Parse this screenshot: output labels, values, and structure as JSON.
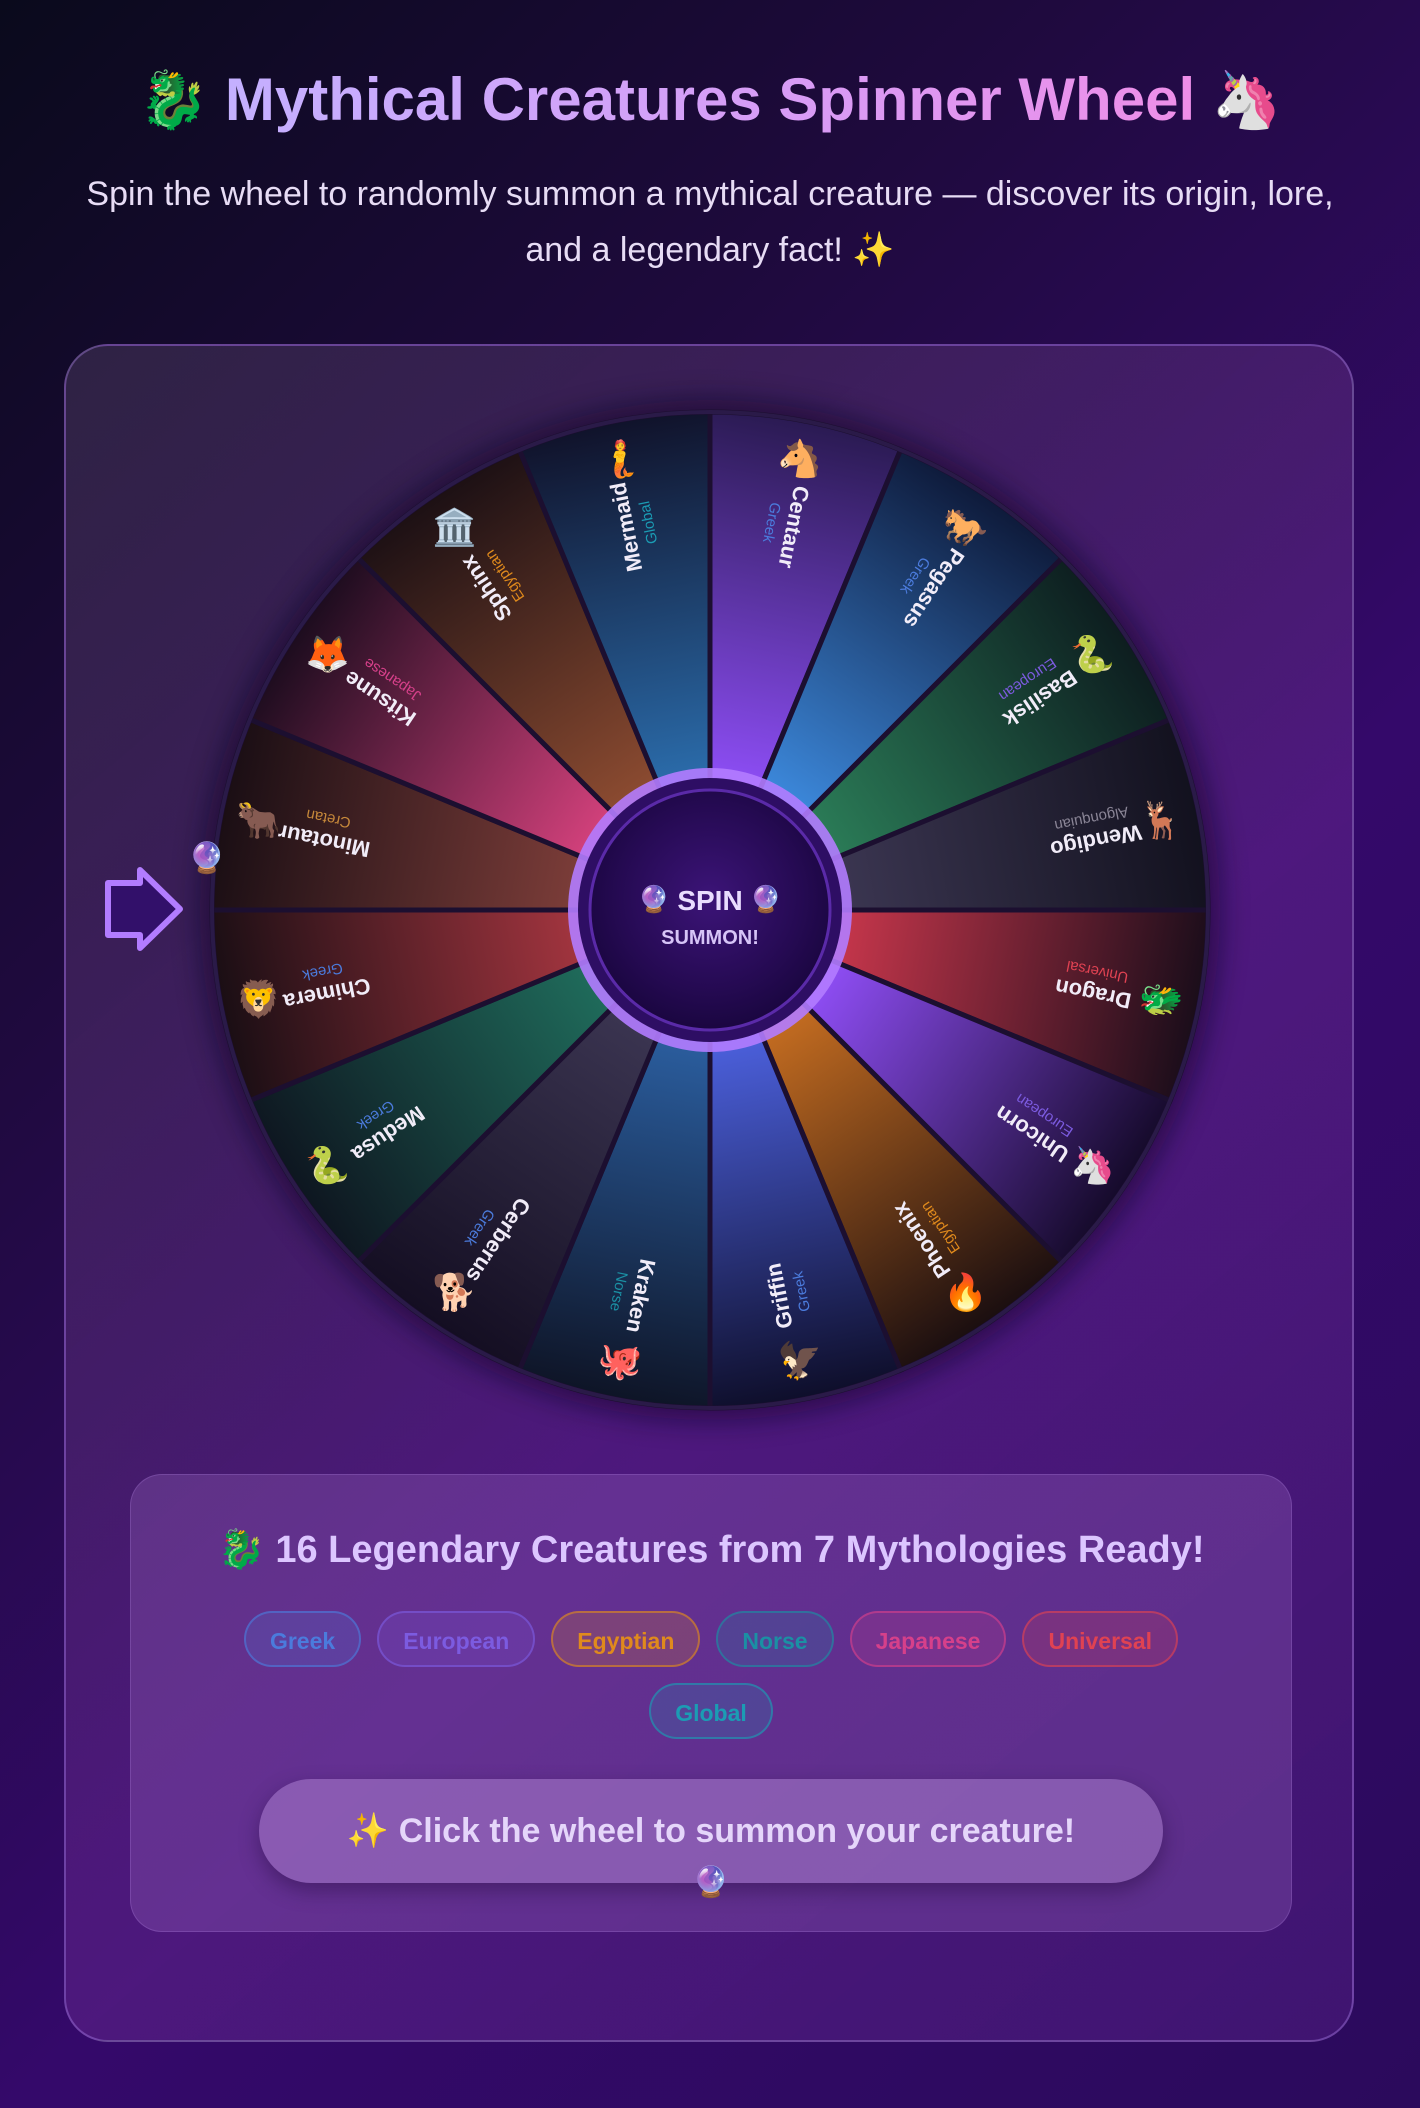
{
  "header": {
    "title_icon_left": "🐉",
    "title": "Mythical Creatures Spinner Wheel",
    "title_icon_right": "🦄",
    "subtitle": "Spin the wheel to randomly summon a mythical creature — discover its origin, lore, and a legendary fact! ✨"
  },
  "wheel": {
    "hub_icon": "🔮",
    "hub_label": "SPIN",
    "hub_sub": "SUMMON!",
    "pointer_icon": "arrow-right-icon",
    "segments": [
      {
        "name": "Centaur",
        "origin": "Greek",
        "emoji": "🐴",
        "colors": [
          "#2a1a52",
          "#8a4cf0"
        ],
        "origin_color": "#4b7bdc"
      },
      {
        "name": "Pegasus",
        "origin": "Greek",
        "emoji": "🐎",
        "colors": [
          "#0e1a3a",
          "#3b86d8"
        ],
        "origin_color": "#4b7bdc"
      },
      {
        "name": "Basilisk",
        "origin": "European",
        "emoji": "🐍",
        "colors": [
          "#0d1d1f",
          "#2a7a56"
        ],
        "origin_color": "#7c5be0"
      },
      {
        "name": "Wendigo",
        "origin": "Algonquian",
        "emoji": "🦌",
        "colors": [
          "#12111e",
          "#3a3550"
        ],
        "origin_color": "#8a8596"
      },
      {
        "name": "Dragon",
        "origin": "Universal",
        "emoji": "🐲",
        "colors": [
          "#1a0d1a",
          "#c2354a"
        ],
        "origin_color": "#e04252"
      },
      {
        "name": "Unicorn",
        "origin": "European",
        "emoji": "🦄",
        "colors": [
          "#150a2a",
          "#8c4cf0"
        ],
        "origin_color": "#7c5be0"
      },
      {
        "name": "Phoenix",
        "origin": "Egyptian",
        "emoji": "🔥",
        "colors": [
          "#1a0e10",
          "#c06a20"
        ],
        "origin_color": "#e08a1c"
      },
      {
        "name": "Griffin",
        "origin": "Greek",
        "emoji": "🦅",
        "colors": [
          "#0e0e2a",
          "#4a5ed8"
        ],
        "origin_color": "#4b7bdc"
      },
      {
        "name": "Kraken",
        "origin": "Norse",
        "emoji": "🐙",
        "colors": [
          "#0e1426",
          "#2a5c9c"
        ],
        "origin_color": "#1b90a4"
      },
      {
        "name": "Cerberus",
        "origin": "Greek",
        "emoji": "🐕",
        "colors": [
          "#140e22",
          "#3a3450"
        ],
        "origin_color": "#4b7bdc"
      },
      {
        "name": "Medusa",
        "origin": "Greek",
        "emoji": "🐍",
        "colors": [
          "#0e1620",
          "#1f6a5a"
        ],
        "origin_color": "#4b7bdc"
      },
      {
        "name": "Chimera",
        "origin": "Greek",
        "emoji": "🦁",
        "colors": [
          "#1a0e14",
          "#a0343e"
        ],
        "origin_color": "#4b7bdc"
      },
      {
        "name": "Minotaur",
        "origin": "Cretan",
        "emoji": "🐂",
        "colors": [
          "#1a0e14",
          "#7a3c38"
        ],
        "origin_color": "#c6883a"
      },
      {
        "name": "Kitsune",
        "origin": "Japanese",
        "emoji": "🦊",
        "colors": [
          "#1c0c1e",
          "#d0407a"
        ],
        "origin_color": "#d6408a"
      },
      {
        "name": "Sphinx",
        "origin": "Egyptian",
        "emoji": "🏛️",
        "colors": [
          "#1c1014",
          "#8a4a30"
        ],
        "origin_color": "#e08a1c"
      },
      {
        "name": "Mermaid",
        "origin": "Global",
        "emoji": "🧜",
        "colors": [
          "#10122a",
          "#2a6aa8"
        ],
        "origin_color": "#1b9cb4"
      }
    ]
  },
  "info": {
    "icon": "🐉",
    "title": "16 Legendary Creatures from 7 Mythologies Ready!",
    "pills": [
      {
        "label": "Greek",
        "color": "#4b7bdc"
      },
      {
        "label": "European",
        "color": "#7c5be0"
      },
      {
        "label": "Egyptian",
        "color": "#e08a1c"
      },
      {
        "label": "Norse",
        "color": "#1b90a4"
      },
      {
        "label": "Japanese",
        "color": "#d6408a"
      },
      {
        "label": "Universal",
        "color": "#e04252"
      },
      {
        "label": "Global",
        "color": "#1b9cb4"
      }
    ],
    "cta_icon": "✨",
    "cta": "Click the wheel to summon your creature!"
  },
  "decor": {
    "crystal_ball": "🔮"
  },
  "colors": {
    "accent": "#a77bff",
    "hub": "#2a0a58"
  }
}
